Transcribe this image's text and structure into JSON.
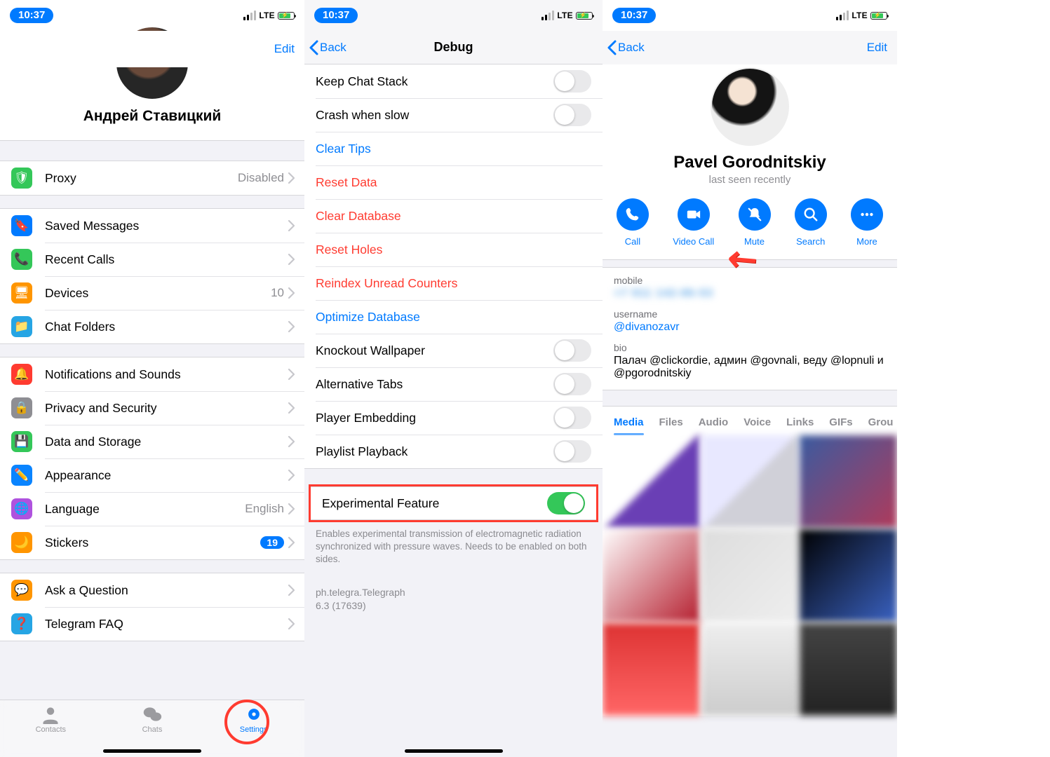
{
  "status": {
    "time": "10:37",
    "network": "LTE"
  },
  "screenA": {
    "edit": "Edit",
    "profile_name": "Андрей Ставицкий",
    "rows1": [
      {
        "icon": "🛡",
        "bg": "#34c759",
        "label": "Proxy",
        "value": "Disabled"
      }
    ],
    "rows2": [
      {
        "icon": "🔖",
        "bg": "#007aff",
        "label": "Saved Messages"
      },
      {
        "icon": "📞",
        "bg": "#34c759",
        "label": "Recent Calls"
      },
      {
        "icon": "🖥",
        "bg": "#ff9500",
        "label": "Devices",
        "value": "10"
      },
      {
        "icon": "📁",
        "bg": "#26a5e4",
        "label": "Chat Folders"
      }
    ],
    "rows3": [
      {
        "icon": "🔔",
        "bg": "#ff3b30",
        "label": "Notifications and Sounds"
      },
      {
        "icon": "🔒",
        "bg": "#8e8e93",
        "label": "Privacy and Security"
      },
      {
        "icon": "💾",
        "bg": "#34c759",
        "label": "Data and Storage"
      },
      {
        "icon": "✏️",
        "bg": "#0a84ff",
        "label": "Appearance"
      },
      {
        "icon": "🌐",
        "bg": "#af52de",
        "label": "Language",
        "value": "English"
      },
      {
        "icon": "🌙",
        "bg": "#ff9500",
        "label": "Stickers",
        "badge": "19"
      }
    ],
    "rows4": [
      {
        "icon": "💬",
        "bg": "#ff9500",
        "label": "Ask a Question"
      },
      {
        "icon": "❓",
        "bg": "#26a5e4",
        "label": "Telegram FAQ"
      }
    ],
    "tabs": {
      "contacts": "Contacts",
      "chats": "Chats",
      "settings": "Settings"
    }
  },
  "screenB": {
    "back": "Back",
    "title": "Debug",
    "items": [
      {
        "label": "Keep Chat Stack",
        "kind": "toggle",
        "on": false
      },
      {
        "label": "Crash when slow",
        "kind": "toggle",
        "on": false
      },
      {
        "label": "Clear Tips",
        "kind": "link-blue"
      },
      {
        "label": "Reset Data",
        "kind": "link-red"
      },
      {
        "label": "Clear Database",
        "kind": "link-red"
      },
      {
        "label": "Reset Holes",
        "kind": "link-red"
      },
      {
        "label": "Reindex Unread Counters",
        "kind": "link-red"
      },
      {
        "label": "Optimize Database",
        "kind": "link-blue"
      },
      {
        "label": "Knockout Wallpaper",
        "kind": "toggle",
        "on": false
      },
      {
        "label": "Alternative Tabs",
        "kind": "toggle",
        "on": false
      },
      {
        "label": "Player Embedding",
        "kind": "toggle",
        "on": false
      },
      {
        "label": "Playlist Playback",
        "kind": "toggle",
        "on": false
      }
    ],
    "experimental": {
      "label": "Experimental Feature",
      "on": true
    },
    "experimental_footer": "Enables experimental transmission of electromagnetic radiation synchronized with pressure waves. Needs to be enabled on both sides.",
    "app_id": "ph.telegra.Telegraph",
    "app_version": "6.3 (17639)"
  },
  "screenC": {
    "back": "Back",
    "edit": "Edit",
    "name": "Pavel Gorodnitskiy",
    "status": "last seen recently",
    "actions": [
      "Call",
      "Video Call",
      "Mute",
      "Search",
      "More"
    ],
    "mobile_label": "mobile",
    "mobile_value": "+7 911 142-86-53",
    "username_label": "username",
    "username_value": "@divanozavr",
    "bio_label": "bio",
    "bio_value": "Палач @clickordie, админ @govnali, веду @lopnuli и @pgorodnitskiy",
    "tabs": [
      "Media",
      "Files",
      "Audio",
      "Voice",
      "Links",
      "GIFs",
      "Grou"
    ]
  }
}
